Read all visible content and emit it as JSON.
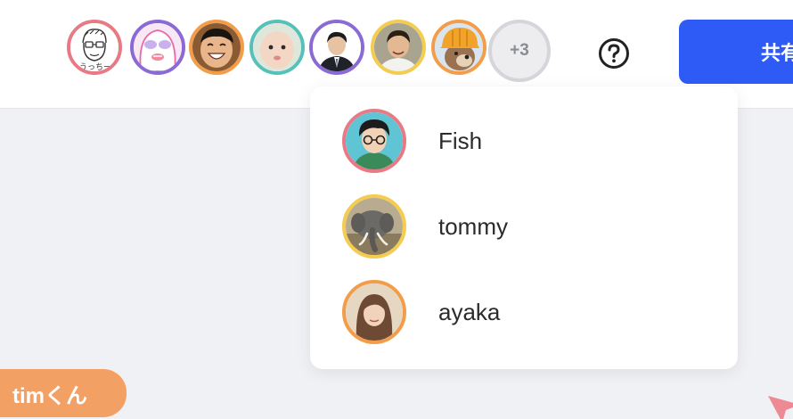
{
  "header": {
    "avatars": [
      {
        "name": "avatar-sketch-face",
        "ring_color": "#e87a86",
        "bg": "#ffffff"
      },
      {
        "name": "avatar-pink-character",
        "ring_color": "#8b6ad6",
        "bg": "#f7e8f4"
      },
      {
        "name": "avatar-laughing-man",
        "ring_color": "#f29d4a",
        "bg": "#8a5a32"
      },
      {
        "name": "avatar-baby",
        "ring_color": "#56c1b8",
        "bg": "#dfe6dc"
      },
      {
        "name": "avatar-man-in-suit",
        "ring_color": "#8b6ad6",
        "bg": "#ffffff"
      },
      {
        "name": "avatar-smiling-man",
        "ring_color": "#f4cc4f",
        "bg": "#a8a48f"
      },
      {
        "name": "avatar-dog-helmet",
        "ring_color": "#f29d4a",
        "bg": "#d8e4ef"
      }
    ],
    "more_count": "+3",
    "help_icon": "question-circle-icon",
    "share_label": "共有"
  },
  "dropdown": {
    "users": [
      {
        "name": "Fish",
        "ring_color": "#e87a86"
      },
      {
        "name": "tommy",
        "ring_color": "#f4cc4f"
      },
      {
        "name": "ayaka",
        "ring_color": "#f29d4a"
      }
    ]
  },
  "cursor_label": "timくん",
  "colors": {
    "accent": "#2e5bf6",
    "cursor_tag": "#f3a064",
    "canvas_bg": "#f0f1f5"
  }
}
